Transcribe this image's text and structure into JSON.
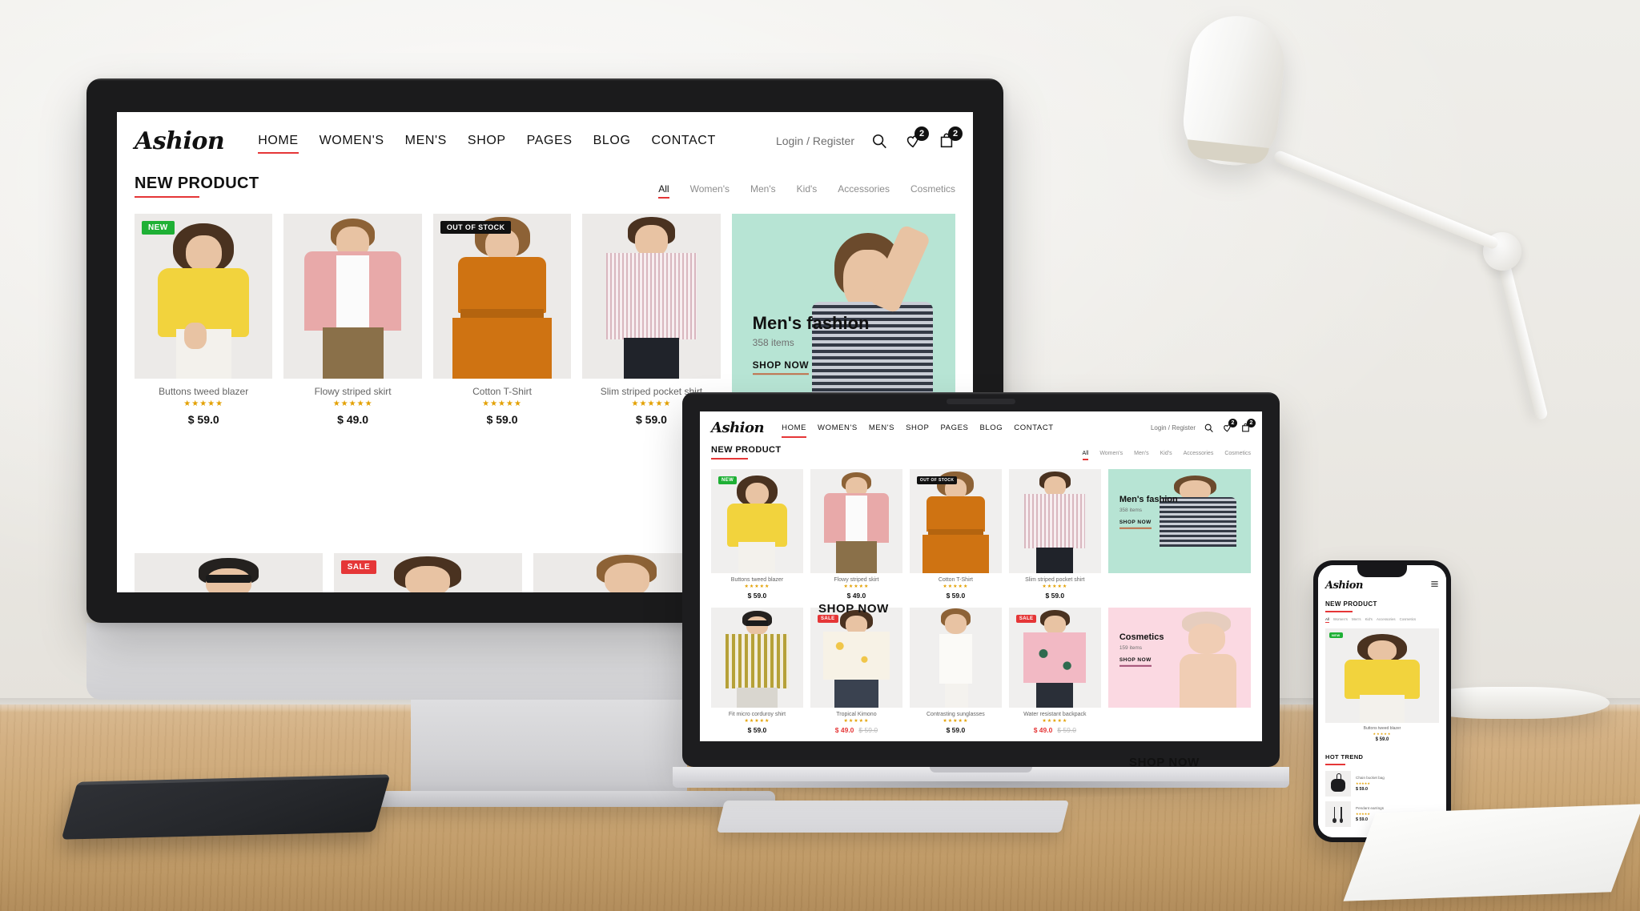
{
  "brand": {
    "logo": "Ashion",
    "accent": "#e53637"
  },
  "nav": {
    "items": [
      "HOME",
      "WOMEN'S",
      "MEN'S",
      "SHOP",
      "PAGES",
      "BLOG",
      "CONTACT"
    ],
    "active": "HOME"
  },
  "header": {
    "login_label": "Login / Register",
    "search_icon": "search-icon",
    "wishlist_icon": "heart-icon",
    "wishlist_count": "2",
    "cart_icon": "bag-icon",
    "cart_count": "2"
  },
  "section": {
    "title": "NEW PRODUCT",
    "filters": [
      "All",
      "Women's",
      "Men's",
      "Kid's",
      "Accessories",
      "Cosmetics"
    ],
    "active_filter": "All"
  },
  "products_row1": [
    {
      "name": "Buttons tweed blazer",
      "price": "$ 59.0",
      "stars": "★★★★★",
      "tag": "NEW",
      "tag_type": "new"
    },
    {
      "name": "Flowy striped skirt",
      "price": "$ 49.0",
      "stars": "★★★★★",
      "tag": "",
      "tag_type": ""
    },
    {
      "name": "Cotton T-Shirt",
      "price": "$ 59.0",
      "stars": "★★★★★",
      "tag": "OUT OF STOCK",
      "tag_type": "oos"
    },
    {
      "name": "Slim striped pocket shirt",
      "price": "$ 59.0",
      "stars": "★★★★★",
      "tag": "",
      "tag_type": ""
    }
  ],
  "products_row2": [
    {
      "name": "Fit micro corduroy shirt",
      "price": "$ 59.0",
      "old_price": "",
      "stars": "★★★★★",
      "tag": "",
      "tag_type": ""
    },
    {
      "name": "Tropical Kimono",
      "price": "$ 49.0",
      "old_price": "$ 59.0",
      "stars": "★★★★★",
      "tag": "SALE",
      "tag_type": "sale"
    },
    {
      "name": "Contrasting sunglasses",
      "price": "$ 59.0",
      "old_price": "",
      "stars": "★★★★★",
      "tag": "",
      "tag_type": ""
    },
    {
      "name": "Water resistant backpack",
      "price": "$ 49.0",
      "old_price": "$ 59.0",
      "stars": "★★★★★",
      "tag": "SALE",
      "tag_type": "sale"
    }
  ],
  "banner_mens": {
    "title": "Men's fashion",
    "items": "358 items",
    "cta": "SHOP NOW",
    "bg": "#b7e4d4"
  },
  "banner_cosmetics": {
    "title": "Cosmetics",
    "items": "159 items",
    "cta": "SHOP NOW",
    "bg": "#fbd9e2"
  },
  "overlay": {
    "shop_now_left": "SHOP NOW",
    "shop_now_right": "SHOP NOW"
  },
  "phone": {
    "menu_icon": "hamburger-menu-icon",
    "hot_trend_title": "HOT TREND",
    "featured": {
      "name": "Buttons tweed blazer",
      "price": "$ 59.0",
      "stars": "★★★★★",
      "tag": "NEW"
    },
    "hot_trend": [
      {
        "name": "Chain bucket bag",
        "price": "$ 59.0",
        "stars": "★★★★★"
      },
      {
        "name": "Pendant earrings",
        "price": "$ 59.0",
        "stars": "★★★★★"
      }
    ]
  }
}
